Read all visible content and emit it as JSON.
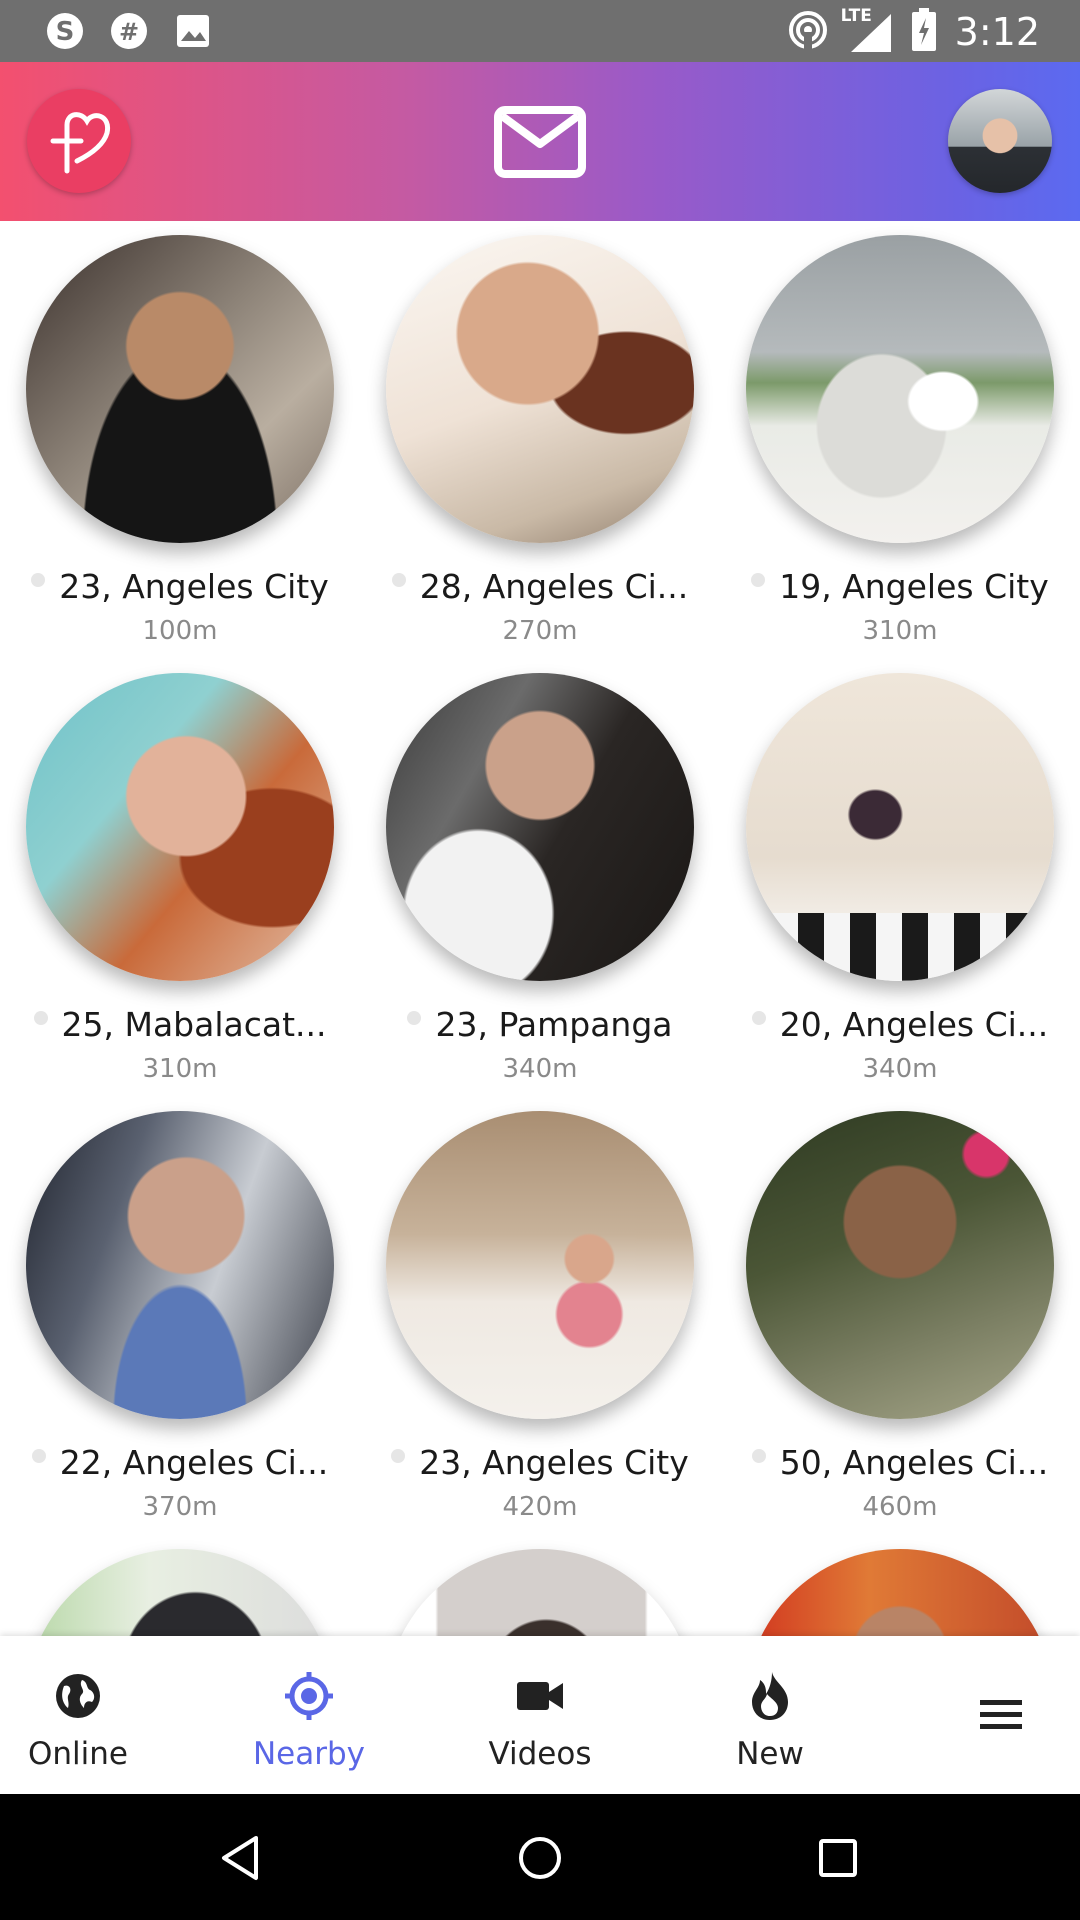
{
  "status_bar": {
    "time": "3:12",
    "network": "LTE",
    "icons": [
      "skype-icon",
      "hash-icon",
      "image-icon",
      "hotspot-icon",
      "signal-icon",
      "battery-icon"
    ]
  },
  "header": {
    "logo_icon": "heart-logo-icon",
    "mail_icon": "mail-icon",
    "avatar": "user-avatar"
  },
  "profiles": [
    {
      "label": "23, Angeles City",
      "distance": "100m"
    },
    {
      "label": "28, Angeles Ci...",
      "distance": "270m"
    },
    {
      "label": "19, Angeles City",
      "distance": "310m"
    },
    {
      "label": "25, Mabalacat...",
      "distance": "310m"
    },
    {
      "label": "23, Pampanga",
      "distance": "340m"
    },
    {
      "label": "20, Angeles Ci...",
      "distance": "340m"
    },
    {
      "label": "22, Angeles Ci...",
      "distance": "370m"
    },
    {
      "label": "23, Angeles City",
      "distance": "420m"
    },
    {
      "label": "50, Angeles Ci...",
      "distance": "460m"
    }
  ],
  "bottom_nav": {
    "items": [
      {
        "label": "Online",
        "icon": "globe-icon"
      },
      {
        "label": "Nearby",
        "icon": "crosshair-icon"
      },
      {
        "label": "Videos",
        "icon": "video-camera-icon"
      },
      {
        "label": "New",
        "icon": "flame-icon"
      }
    ],
    "menu_icon": "hamburger-menu-icon",
    "active": "Nearby"
  },
  "colors": {
    "accent": "#5a67e6",
    "header_start": "#f3506f",
    "header_end": "#5b6af0",
    "logo_bg": "#ea3e63"
  }
}
